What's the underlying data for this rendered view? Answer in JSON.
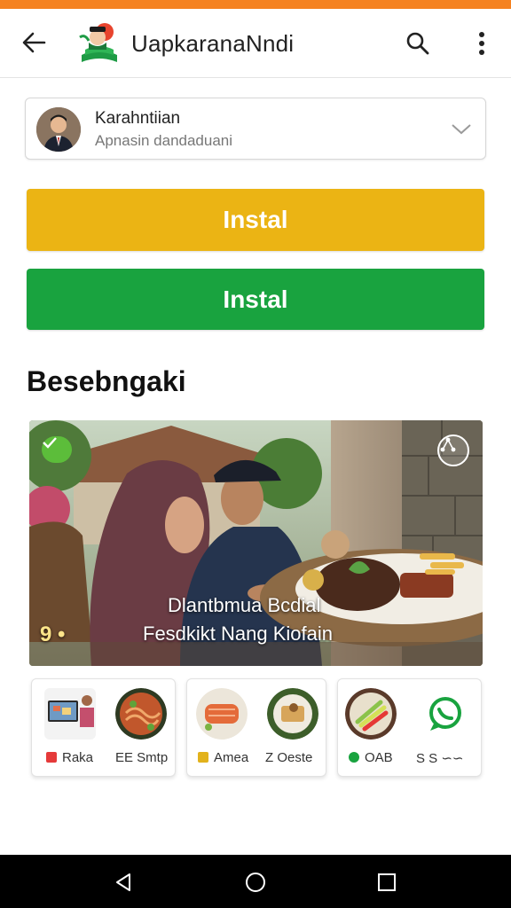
{
  "theme": {
    "accent": "#f58220",
    "yellow_button": "#ebb414",
    "green_button": "#19a33f"
  },
  "app_bar": {
    "title": "UapkaranaNndi",
    "icons": [
      "back-arrow-icon",
      "app-logo",
      "search-icon",
      "more-vert-icon"
    ]
  },
  "account": {
    "name": "Karahntiian",
    "subtitle": "Apnasin dandaduani",
    "icon": "chevron-down-icon"
  },
  "buttons": {
    "primary_label": "Instal",
    "secondary_label": "Instal"
  },
  "section": {
    "title": "Besebngaki"
  },
  "feature": {
    "caption_line1": "Dlantbmua Bcdial",
    "caption_line2": "Fesdkikt Nang Kiofain",
    "badge": "9 •",
    "icons": [
      "check-badge-icon",
      "share-circle-icon"
    ]
  },
  "tiles": [
    {
      "left_label": "Raka",
      "right_label": "EE Smtp"
    },
    {
      "left_label": "Amea",
      "right_label": "Z Oeste"
    },
    {
      "left_label": "OAB",
      "right_label": "S S ∽∽"
    }
  ],
  "nav": {
    "icons": [
      "nav-back-icon",
      "nav-home-icon",
      "nav-recents-icon"
    ]
  }
}
